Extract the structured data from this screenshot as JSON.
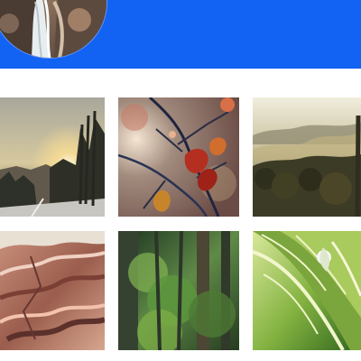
{
  "header": {
    "background_color": "#1262f4",
    "avatar": {
      "icon": "waterfall-profile-photo"
    }
  },
  "gallery": {
    "photos": [
      {
        "subject": "sunset-road-forest"
      },
      {
        "subject": "red-leaves-branches"
      },
      {
        "subject": "misty-valley-forest"
      },
      {
        "subject": "red-rocks"
      },
      {
        "subject": "green-forest"
      },
      {
        "subject": "green-leaf"
      }
    ]
  }
}
